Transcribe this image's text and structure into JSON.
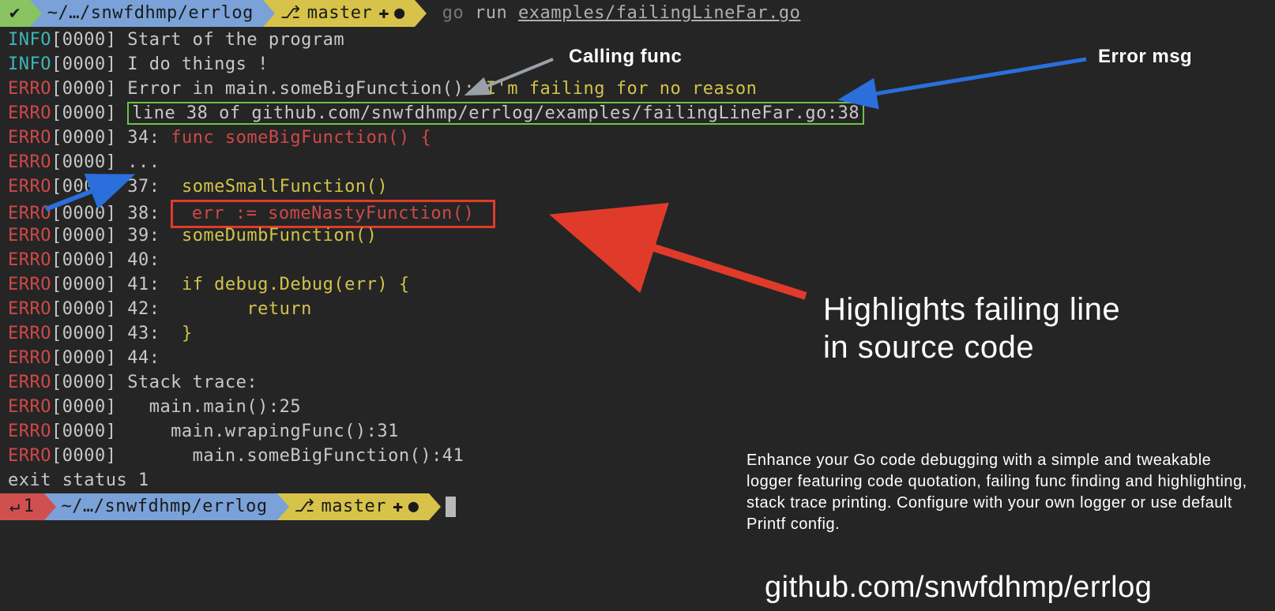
{
  "top_prompt": {
    "check": "✔",
    "path": "~/…/snwfdhmp/errlog",
    "vcs_icon": "⎇",
    "branch": "master",
    "plus": "✚",
    "dot": "●",
    "cmd_go": "go",
    "cmd_run": "run",
    "cmd_path": "examples/failingLineFar.go"
  },
  "lines": [
    {
      "level": "INFO",
      "ts": "[0000]",
      "plain": "Start of the program"
    },
    {
      "level": "INFO",
      "ts": "[0000]",
      "plain": "I do things !"
    },
    {
      "level": "ERRO",
      "ts": "[0000]",
      "pre": "Error in main.someBigFunction(): ",
      "yel": "I'm failing for no reason"
    },
    {
      "level": "ERRO",
      "ts": "[0000]",
      "gbox": "line 38 of github.com/snwfdhmp/errlog/examples/failingLineFar.go:38"
    },
    {
      "level": "ERRO",
      "ts": "[0000]",
      "num": "34:",
      "red": " func someBigFunction() {"
    },
    {
      "level": "ERRO",
      "ts": "[0000]",
      "plain": "..."
    },
    {
      "level": "ERRO",
      "ts": "[0000]",
      "num": "37:",
      "yel": "  someSmallFunction()"
    },
    {
      "level": "ERRO",
      "ts": "[0000]",
      "num": "38:",
      "rbox": " err := someNastyFunction() "
    },
    {
      "level": "ERRO",
      "ts": "[0000]",
      "num": "39:",
      "yel": "  someDumbFunction()"
    },
    {
      "level": "ERRO",
      "ts": "[0000]",
      "num": "40:"
    },
    {
      "level": "ERRO",
      "ts": "[0000]",
      "num": "41:",
      "yel": "  if debug.Debug(err) {"
    },
    {
      "level": "ERRO",
      "ts": "[0000]",
      "num": "42:",
      "yel": "        return"
    },
    {
      "level": "ERRO",
      "ts": "[0000]",
      "num": "43:",
      "yel": "  }"
    },
    {
      "level": "ERRO",
      "ts": "[0000]",
      "num": "44:"
    },
    {
      "level": "ERRO",
      "ts": "[0000]",
      "plain": "Stack trace:"
    },
    {
      "level": "ERRO",
      "ts": "[0000]",
      "plain": "  main.main():25"
    },
    {
      "level": "ERRO",
      "ts": "[0000]",
      "plain": "    main.wrapingFunc():31"
    },
    {
      "level": "ERRO",
      "ts": "[0000]",
      "plain": "      main.someBigFunction():41"
    }
  ],
  "exit": "exit status 1",
  "bottom_prompt": {
    "ret_icon": "↵",
    "ret_code": "1",
    "path": "~/…/snwfdhmp/errlog",
    "vcs_icon": "⎇",
    "branch": "master",
    "plus": "✚",
    "dot": "●"
  },
  "annotations": {
    "calling_func": "Calling func",
    "error_msg": "Error msg",
    "failing_line_1": "Highlights failing line",
    "failing_line_2": "in source code",
    "blurb": "Enhance your Go code debugging with a simple and tweakable logger featuring code quotation, failing func finding and highlighting, stack trace printing. Configure with your own logger or use default Printf config.",
    "url": "github.com/snwfdhmp/errlog"
  }
}
